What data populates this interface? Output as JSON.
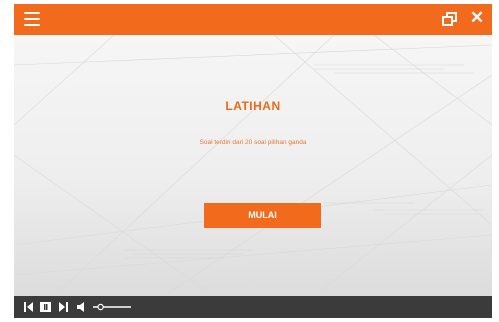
{
  "app": {
    "accent_color": "#f26a1b",
    "controls_color": "#3b3b3b"
  },
  "topbar": {
    "menu_icon": "hamburger-menu-icon",
    "restore_icon": "restore-window-icon",
    "close_icon": "close-icon",
    "close_glyph": "✕"
  },
  "content": {
    "title": "LATIHAN",
    "subtitle": "Soal terdiri dari 20 soal pilihan ganda",
    "start_label": "MULAI"
  },
  "player": {
    "icons": [
      "skip-back-icon",
      "pause-icon",
      "skip-forward-icon",
      "volume-icon",
      "volume-slider"
    ],
    "volume_level": 0.2
  }
}
